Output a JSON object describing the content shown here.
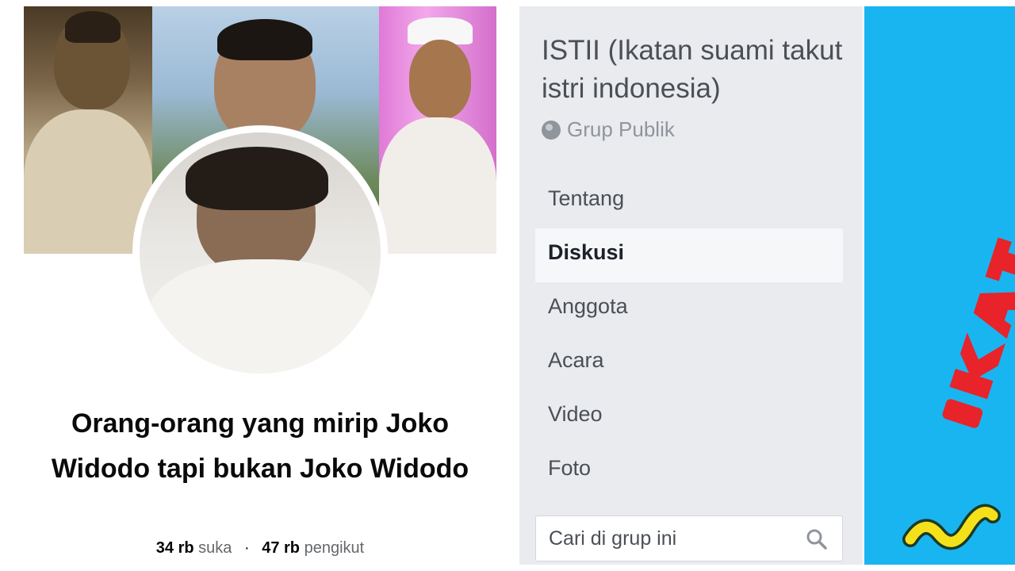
{
  "page": {
    "title": "Orang-orang yang mirip Joko Widodo tapi bukan Joko Widodo",
    "likes_count": "34 rb",
    "likes_label": "suka",
    "separator": "·",
    "followers_count": "47 rb",
    "followers_label": "pengikut"
  },
  "group": {
    "name": "ISTII (Ikatan suami takut istri indonesia)",
    "privacy": "Grup Publik",
    "privacy_icon": "globe-icon",
    "nav": [
      {
        "label": "Tentang",
        "active": false
      },
      {
        "label": "Diskusi",
        "active": true
      },
      {
        "label": "Anggota",
        "active": false
      },
      {
        "label": "Acara",
        "active": false
      },
      {
        "label": "Video",
        "active": false
      },
      {
        "label": "Foto",
        "active": false
      }
    ],
    "search": {
      "placeholder": "Cari di grup ini",
      "icon": "search-icon"
    }
  },
  "colors": {
    "panel_bg": "#e9ebee",
    "cover_blue": "#19b5f0",
    "logo_red": "#e8232a",
    "logo_yellow": "#f5e11a"
  }
}
